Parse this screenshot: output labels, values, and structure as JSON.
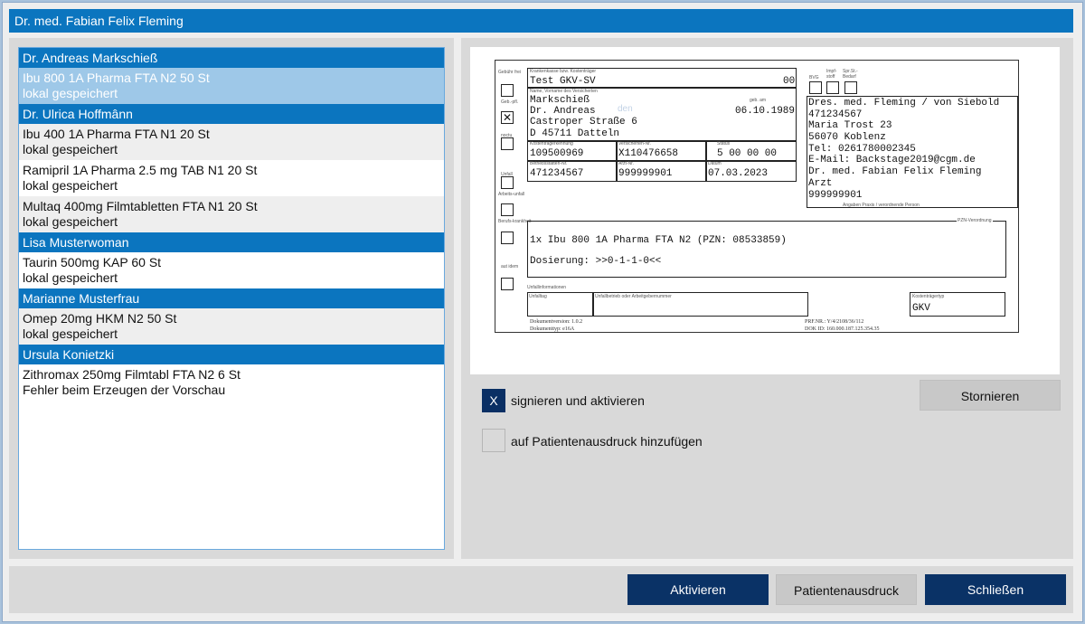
{
  "window": {
    "title": "Dr. med. Fabian Felix Fleming"
  },
  "list": {
    "groups": [
      {
        "header": "Dr. Andreas Markschieß",
        "items": [
          {
            "name": "Ibu 800 1A Pharma FTA N2 50 St",
            "status": "lokal gespeichert"
          }
        ]
      },
      {
        "header": "Dr. Ulrica Hoffmânn",
        "items": [
          {
            "name": "Ibu 400 1A Pharma FTA N1 20 St",
            "status": "lokal gespeichert"
          },
          {
            "name": "Ramipril 1A Pharma 2.5 mg TAB N1 20 St",
            "status": "lokal gespeichert"
          },
          {
            "name": "Multaq 400mg Filmtabletten FTA N1 20 St",
            "status": "lokal gespeichert"
          }
        ]
      },
      {
        "header": "Lisa Musterwoman",
        "items": [
          {
            "name": "Taurin 500mg KAP 60 St",
            "status": "lokal gespeichert"
          }
        ]
      },
      {
        "header": "Marianne Musterfrau",
        "items": [
          {
            "name": "Omep 20mg HKM N2 50 St",
            "status": "lokal gespeichert"
          }
        ]
      },
      {
        "header": "Ursula Konietzki",
        "items": [
          {
            "name": "Zithromax 250mg Filmtabl FTA N2 6 St",
            "status": "Fehler beim Erzeugen der Vorschau"
          }
        ]
      }
    ]
  },
  "rx": {
    "krankenkasse_label": "Krankenkasse bzw. Kostenträger",
    "krankenkasse": "Test GKV-SV",
    "kk_code": "00",
    "name_label": "Name, Vorname des Versicherten",
    "geb_label": "geb. am",
    "lines": [
      "Markschieß",
      "Dr. Andreas",
      "Castroper Straße 6",
      "D 45711 Datteln"
    ],
    "geb": "06.10.1989",
    "kostentraeger_label": "Kostenträgerkennung",
    "kostentraeger": "109500969",
    "versnr_label": "Versicherten-Nr.",
    "versnr": "X110476658",
    "status_label": "Status",
    "status": "5 00 00 00",
    "bsnr_label": "Betriebsstätten-Nr.",
    "bsnr": "471234567",
    "lanr_label": "Arzt-Nr.",
    "lanr": "999999901",
    "datum_label": "Datum",
    "datum": "07.03.2023",
    "left_labels": [
      "Gebühr frei",
      "Geb.-pfl.",
      "noctu",
      "Unfall",
      "Arbeits-unfall",
      "Berufs-krankheit",
      "aut idem"
    ],
    "top_labels": [
      "BVG",
      "Impf-stoff",
      "Spr.St.-Bedarf"
    ],
    "doctor_lines": [
      "Dres. med. Fleming / von Siebold",
      "471234567",
      "Maria Trost  23",
      "56070 Koblenz",
      "Tel: 0261780002345",
      "E-Mail: Backstage2019@cgm.de",
      "Dr. med. Fabian Felix Fleming",
      "Arzt",
      "999999901"
    ],
    "doctor_caption": "Angaben Praxis / verordnende Person",
    "pzn_label": "PZN-Verordnung",
    "verordnung": "1x Ibu 800 1A Pharma FTA N2 (PZN: 08533859)",
    "dosierung": "Dosierung: >>0-1-1-0<<",
    "unfallinfo_label": "Unfallinformationen",
    "unfalltag_label": "Unfalltag",
    "unfallbetrieb_label": "Unfallbetrieb oder Arbeitgebernummer",
    "kostentraegertyp_label": "Kostenträgertyp",
    "kostentraegertyp": "GKV",
    "footer_left": [
      "Dokumentversion: 1.0.2",
      "Dokumenttyp: e16A"
    ],
    "footer_right": [
      "PRF.NR.: Y/4/2108/36/112",
      "DOK ID: 160.000.187.125.354.35"
    ],
    "overlay_text": "den"
  },
  "options": {
    "sign_label": "signieren und aktivieren",
    "sign_checked_mark": "X",
    "print_label": "auf Patientenausdruck hinzufügen"
  },
  "buttons": {
    "cancel": "Stornieren",
    "activate": "Aktivieren",
    "patient_print": "Patientenausdruck",
    "close": "Schließen"
  },
  "colors": {
    "accent": "#0b75bf",
    "dark_button": "#0a3266",
    "selection": "#9ec8e8"
  }
}
